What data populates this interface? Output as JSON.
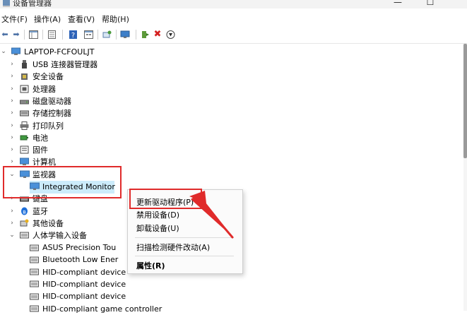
{
  "window": {
    "title": "设备管理器",
    "minimize": "—",
    "maximize": "☐"
  },
  "menu": [
    "文件(F)",
    "操作(A)",
    "查看(V)",
    "帮助(H)"
  ],
  "toolbar": {
    "icons": [
      "back-arrow-icon",
      "forward-arrow-icon",
      "console-tree-icon",
      "properties-icon",
      "help-icon",
      "view-icon",
      "scan-icon",
      "monitor-icon",
      "update-driver-icon",
      "uninstall-icon",
      "disable-icon"
    ]
  },
  "tree": {
    "root": "LAPTOP-FCFOULJT",
    "items": [
      {
        "label": "USB 连接器管理器",
        "icon": "usb-icon",
        "expanded": false
      },
      {
        "label": "安全设备",
        "icon": "security-icon",
        "expanded": false
      },
      {
        "label": "处理器",
        "icon": "processor-icon",
        "expanded": false
      },
      {
        "label": "磁盘驱动器",
        "icon": "disk-icon",
        "expanded": false
      },
      {
        "label": "存储控制器",
        "icon": "storage-icon",
        "expanded": false
      },
      {
        "label": "打印队列",
        "icon": "printer-icon",
        "expanded": false
      },
      {
        "label": "电池",
        "icon": "battery-icon",
        "expanded": false
      },
      {
        "label": "固件",
        "icon": "firmware-icon",
        "expanded": false
      },
      {
        "label": "计算机",
        "icon": "computer-icon",
        "expanded": false
      },
      {
        "label": "监视器",
        "icon": "monitor-icon",
        "expanded": true
      },
      {
        "label": "Integrated Monitor",
        "icon": "monitor-icon",
        "child": true
      },
      {
        "label": "键盘",
        "icon": "keyboard-icon",
        "expanded": false
      },
      {
        "label": "蓝牙",
        "icon": "bluetooth-icon",
        "expanded": false
      },
      {
        "label": "其他设备",
        "icon": "other-device-icon",
        "expanded": false
      },
      {
        "label": "人体学输入设备",
        "icon": "hid-icon",
        "expanded": true
      },
      {
        "label": "ASUS Precision Tou",
        "icon": "hid-icon",
        "child": true
      },
      {
        "label": "Bluetooth Low Ener",
        "icon": "hid-icon",
        "child": true
      },
      {
        "label": "HID-compliant device",
        "icon": "hid-icon",
        "child": true
      },
      {
        "label": "HID-compliant device",
        "icon": "hid-icon",
        "child": true
      },
      {
        "label": "HID-compliant device",
        "icon": "hid-icon",
        "child": true
      },
      {
        "label": "HID-compliant game controller",
        "icon": "hid-icon",
        "child": true
      }
    ]
  },
  "context_menu": {
    "items": [
      "更新驱动程序(P)",
      "禁用设备(D)",
      "卸载设备(U)",
      "扫描检测硬件改动(A)",
      "属性(R)"
    ]
  },
  "colors": {
    "highlight": "#e02b2b",
    "selection": "#ccecfb",
    "monitor": "#4a90d9"
  }
}
